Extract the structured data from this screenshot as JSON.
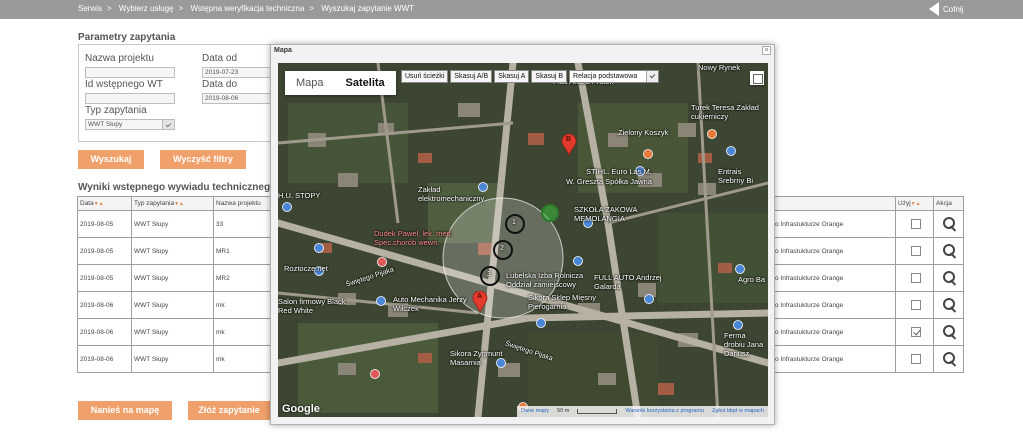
{
  "breadcrumb": [
    "Serwis",
    "Wybierz usługę",
    "Wstępna weryfikacja techniczna",
    "Wyszukaj zapytanie WWT"
  ],
  "back_label": "Cofnij",
  "filters": {
    "title": "Parametry zapytania",
    "project_name_label": "Nazwa projektu",
    "project_name_value": "",
    "id_label": "Id wstępnego WT",
    "id_value": "",
    "type_label": "Typ zapytania",
    "type_value": "WWT Słupy",
    "date_from_label": "Data od",
    "date_from_value": "2019-07-23",
    "date_to_label": "Data do",
    "date_to_value": "2019-08-06"
  },
  "buttons": {
    "search": "Wyszukaj",
    "clear": "Wyczyść filtry",
    "map": "Nanieś na mapę",
    "submit": "Złóż zapytanie"
  },
  "results": {
    "title": "Wyniki wstępnego wywiadu techniczneg",
    "columns": [
      "Data",
      "Typ zapytania",
      "Nazwa projektu"
    ],
    "right_columns": [
      "Użyj",
      "Akcja"
    ],
    "rows": [
      {
        "date": "2019-08-05",
        "type": "WWT Słupy",
        "name": "33",
        "info": "o Infrastukturze Orange",
        "use": false
      },
      {
        "date": "2019-08-05",
        "type": "WWT Słupy",
        "name": "MR1",
        "info": "o Infrastukturze Orange",
        "use": false
      },
      {
        "date": "2019-08-05",
        "type": "WWT Słupy",
        "name": "MR2",
        "info": "o Infrastukturze Orange",
        "use": false
      },
      {
        "date": "2019-08-06",
        "type": "WWT Słupy",
        "name": "mk",
        "info": "o Infrastukturze Orange",
        "use": false
      },
      {
        "date": "2019-08-06",
        "type": "WWT Słupy",
        "name": "mk",
        "info": "o Infrastukturze Orange",
        "use": true
      },
      {
        "date": "2019-08-06",
        "type": "WWT Słupy",
        "name": "mk",
        "info": "o Infrastukturze Orange",
        "use": false
      }
    ]
  },
  "modal": {
    "title": "Mapa",
    "close": "×",
    "map_types": [
      "Mapa",
      "Satelita"
    ],
    "active_map_type": "Satelita",
    "map_buttons": [
      "Usuń ścieżki",
      "Skasuj A/B",
      "Skasuj A",
      "Skasuj B"
    ],
    "relation_select": "Relacja podstawowa",
    "google": "Google",
    "attribution": [
      "Dane mapy",
      "50 m",
      "Warunki korzystania z programu",
      "Zgłoś błąd w mapach"
    ],
    "marker_a": "A",
    "marker_b": "B",
    "waypoints": [
      "1",
      "2",
      "3"
    ],
    "places": [
      "Nowy Rynek",
      "Plac Artura Pratek",
      "Turek Teresa Zakład cukierniczy",
      "Zielony Koszyk",
      "STIHL. Euro Las M.",
      "W. Greszta Spółka Jawna",
      "Entrais Srebrny Bi",
      "H.U. STOPY",
      "Zakład elektromechaniczny",
      "SZKOŁA ŻAKOWA MEMOLANGIA",
      "Dudek Paweł, lek. med. Spec.chorób wewn.",
      "Roztocze.net",
      "Świętego Pijaka",
      "Lubelska Izba Rolnicza Oddział zamiejscowy",
      "FULL AUTO Andrzej Galarda",
      "Agro Ba",
      "Salon firmowy Black Red White",
      "Auto Mechanika Jerzy Wilczek",
      "Sikora Sklep Mięsny Pierogarnia",
      "Ferma drobiu Jana Dariusz",
      "Sikora Zygmunt Masarnia",
      "Świętego Pijaka"
    ]
  },
  "colors": {
    "topbar": "#9a9a9a",
    "accent": "#f0a06a",
    "marker": "#e23b2e",
    "map_bg": "#3f4a33"
  }
}
